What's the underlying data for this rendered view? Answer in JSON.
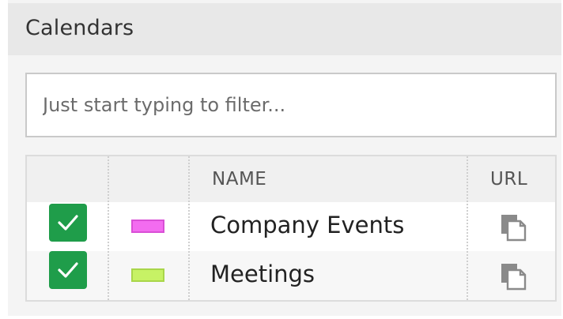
{
  "panel": {
    "title": "Calendars"
  },
  "filter": {
    "placeholder": "Just start typing to filter...",
    "value": ""
  },
  "table": {
    "columns": {
      "select": "",
      "color": "",
      "name": "NAME",
      "url": "URL"
    },
    "rows": [
      {
        "name": "Company Events",
        "checked": true,
        "color": "#f36cf0",
        "url_icon": "copy-icon"
      },
      {
        "name": "Meetings",
        "checked": true,
        "color": "#c7f265",
        "url_icon": "copy-icon"
      }
    ]
  },
  "colors": {
    "checkbox": "#1f9d4a",
    "header_bg": "#e8e8e8"
  }
}
